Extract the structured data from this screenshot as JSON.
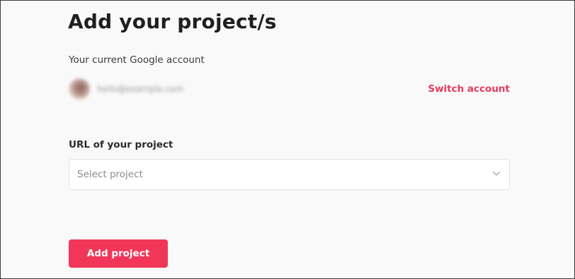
{
  "page": {
    "title": "Add your project/s"
  },
  "account": {
    "label": "Your current Google account",
    "email_blurred": "hello@example.com",
    "switch_label": "Switch account"
  },
  "project": {
    "url_label": "URL of your project",
    "select_placeholder": "Select project"
  },
  "actions": {
    "add_label": "Add project"
  },
  "colors": {
    "accent": "#f2365a",
    "link": "#e6385d",
    "background": "#f9f9f9"
  },
  "icons": {
    "select_chevron": "chevron-down-icon",
    "avatar": "avatar"
  }
}
